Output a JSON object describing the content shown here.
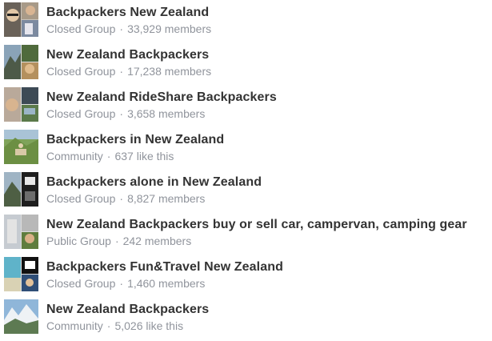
{
  "groups": [
    {
      "name": "Backpackers New Zealand",
      "type": "Closed Group",
      "count": "33,929 members",
      "thumb_icon": "group-collage-thumbnail"
    },
    {
      "name": "New Zealand Backpackers",
      "type": "Closed Group",
      "count": "17,238 members",
      "thumb_icon": "group-collage-thumbnail"
    },
    {
      "name": "New Zealand RideShare Backpackers",
      "type": "Closed Group",
      "count": "3,658 members",
      "thumb_icon": "group-collage-thumbnail"
    },
    {
      "name": "Backpackers in New Zealand",
      "type": "Community",
      "count": "637 like this",
      "thumb_icon": "landscape-thumbnail"
    },
    {
      "name": "Backpackers alone in New Zealand",
      "type": "Closed Group",
      "count": "8,827 members",
      "thumb_icon": "group-collage-thumbnail"
    },
    {
      "name": "New Zealand Backpackers buy or sell car, campervan, camping gear",
      "type": "Public Group",
      "count": "242 members",
      "thumb_icon": "group-collage-thumbnail"
    },
    {
      "name": "Backpackers Fun&Travel New Zealand",
      "type": "Closed Group",
      "count": "1,460 members",
      "thumb_icon": "group-collage-thumbnail"
    },
    {
      "name": "New Zealand Backpackers",
      "type": "Community",
      "count": "5,026 like this",
      "thumb_icon": "landscape-thumbnail"
    }
  ],
  "separator": "·",
  "colors": {
    "name": "#333333",
    "meta": "#90949c",
    "background": "#ffffff"
  }
}
